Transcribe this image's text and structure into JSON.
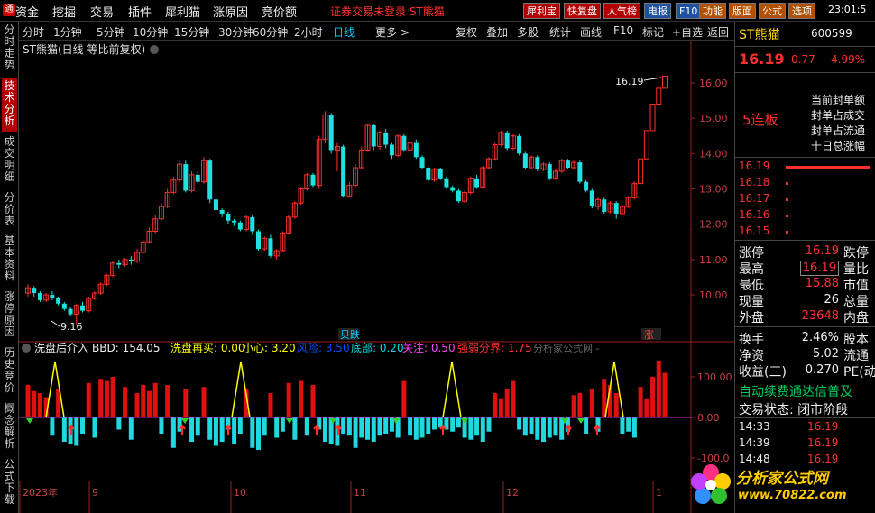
{
  "menubar": {
    "items": [
      "资金",
      "挖掘",
      "交易",
      "插件",
      "犀利猫",
      "涨原因",
      "竞价额"
    ],
    "login_status": "证券交易未登录  ST熊猫",
    "buttons": [
      "犀利宝",
      "快复盘",
      "人气榜",
      "电报",
      "F10",
      "功能",
      "版面",
      "公式",
      "选项"
    ],
    "clock": "23:01:5"
  },
  "left_tabs": [
    "分时走势",
    "技术分析",
    "成交明细",
    "分价表",
    "基本资料",
    "涨停原因",
    "历史竞价",
    "概念解析",
    "公式下载"
  ],
  "left_tabs_active": "技术分析",
  "periods": [
    "分时",
    "1分钟",
    "5分钟",
    "10分钟",
    "15分钟",
    "30分钟",
    "60分钟",
    "2小时",
    "日线",
    "更多 >"
  ],
  "period_selected": "日线",
  "tools": [
    "复权",
    "叠加",
    "多股",
    "统计",
    "画线",
    "F10",
    "标记",
    "+自选",
    "返回"
  ],
  "chart": {
    "title": "ST熊猫(日线 等比前复权)",
    "high_label": "16.19",
    "low_label": "9.16",
    "event_label_1": "贝跌",
    "event_label_2": "涨",
    "price_axis": [
      "16.00",
      "15.00",
      "14.00",
      "13.00",
      "12.00",
      "11.00",
      "10.00"
    ],
    "indicator_axis": [
      "100.00",
      "0.00",
      "-100.0"
    ],
    "x_labels": [
      "2023年",
      "9",
      "10",
      "11",
      "12",
      "1"
    ]
  },
  "indicator": {
    "name": "洗盘后介入",
    "bbd": "BBD: 154.05",
    "xipan": "洗盘再买: 0.00",
    "xiaoxin": "小心: 3.20",
    "fengxian": "风险: 3.50",
    "dibu": "底部: 0.20",
    "guanzhu": "关注: 0.50",
    "qiangruo": "强弱分界: 1.75",
    "source": "分析家公式网 -"
  },
  "chart_data": {
    "type": "candlestick",
    "candles": [
      [
        10.05,
        10.2,
        10.3,
        9.95
      ],
      [
        10.2,
        10.05,
        10.25,
        9.95
      ],
      [
        10.05,
        9.85,
        10.1,
        9.8
      ],
      [
        9.85,
        10.0,
        10.05,
        9.8
      ],
      [
        10.0,
        9.9,
        10.1,
        9.85
      ],
      [
        9.9,
        9.75,
        9.95,
        9.7
      ],
      [
        9.75,
        9.6,
        9.8,
        9.55
      ],
      [
        9.6,
        9.45,
        9.65,
        9.4
      ],
      [
        9.45,
        9.7,
        9.75,
        9.16
      ],
      [
        9.7,
        9.55,
        9.8,
        9.5
      ],
      [
        9.55,
        9.9,
        9.95,
        9.5
      ],
      [
        9.9,
        10.05,
        10.1,
        9.85
      ],
      [
        10.05,
        10.3,
        10.35,
        10.0
      ],
      [
        10.3,
        10.55,
        10.6,
        10.25
      ],
      [
        10.55,
        10.9,
        10.95,
        10.5
      ],
      [
        10.9,
        10.85,
        11.0,
        10.75
      ],
      [
        10.85,
        11.0,
        11.05,
        10.8
      ],
      [
        11.0,
        10.95,
        11.1,
        10.85
      ],
      [
        10.95,
        11.2,
        11.3,
        10.9
      ],
      [
        11.2,
        11.5,
        11.55,
        11.15
      ],
      [
        11.5,
        11.8,
        11.9,
        11.45
      ],
      [
        11.8,
        12.15,
        12.25,
        11.75
      ],
      [
        12.15,
        12.5,
        12.6,
        12.1
      ],
      [
        12.5,
        12.9,
        13.0,
        12.45
      ],
      [
        12.9,
        13.25,
        13.35,
        12.85
      ],
      [
        13.25,
        13.7,
        13.8,
        13.2
      ],
      [
        13.7,
        12.95,
        13.8,
        12.9
      ],
      [
        12.95,
        13.4,
        13.5,
        12.9
      ],
      [
        13.4,
        13.2,
        13.5,
        13.15
      ],
      [
        13.2,
        13.8,
        13.9,
        13.15
      ],
      [
        13.8,
        12.7,
        13.85,
        12.6
      ],
      [
        12.7,
        12.4,
        12.75,
        12.3
      ],
      [
        12.4,
        12.3,
        12.45,
        12.2
      ],
      [
        12.3,
        12.1,
        12.35,
        12.0
      ],
      [
        12.1,
        12.05,
        12.15,
        11.95
      ],
      [
        12.05,
        11.85,
        12.1,
        11.8
      ],
      [
        11.85,
        12.2,
        12.25,
        11.8
      ],
      [
        12.2,
        11.8,
        12.25,
        11.7
      ],
      [
        11.8,
        11.3,
        11.85,
        11.25
      ],
      [
        11.3,
        11.6,
        11.65,
        11.25
      ],
      [
        11.6,
        11.1,
        11.7,
        11.05
      ],
      [
        11.1,
        11.25,
        11.3,
        11.0
      ],
      [
        11.25,
        11.75,
        11.8,
        11.2
      ],
      [
        11.75,
        12.2,
        12.25,
        11.7
      ],
      [
        12.2,
        12.6,
        12.65,
        12.15
      ],
      [
        12.6,
        13.0,
        13.05,
        12.55
      ],
      [
        13.0,
        13.4,
        13.45,
        12.95
      ],
      [
        13.4,
        13.1,
        13.45,
        13.05
      ],
      [
        13.1,
        14.4,
        14.5,
        13.0
      ],
      [
        14.4,
        15.1,
        15.2,
        14.3
      ],
      [
        15.1,
        14.1,
        15.15,
        14.0
      ],
      [
        14.1,
        14.2,
        14.3,
        13.5
      ],
      [
        14.2,
        12.8,
        14.25,
        12.75
      ],
      [
        12.8,
        13.1,
        13.2,
        12.75
      ],
      [
        13.1,
        13.6,
        13.7,
        13.05
      ],
      [
        13.6,
        14.1,
        14.2,
        13.55
      ],
      [
        14.1,
        14.8,
        14.85,
        14.05
      ],
      [
        14.8,
        14.2,
        14.85,
        14.1
      ],
      [
        14.2,
        14.6,
        14.65,
        14.1
      ],
      [
        14.6,
        14.25,
        14.7,
        14.15
      ],
      [
        14.25,
        13.95,
        14.3,
        13.85
      ],
      [
        13.95,
        14.5,
        14.55,
        13.9
      ],
      [
        14.5,
        14.1,
        14.55,
        14.05
      ],
      [
        14.1,
        14.3,
        14.35,
        14.05
      ],
      [
        14.3,
        13.9,
        14.4,
        13.85
      ],
      [
        13.9,
        13.6,
        13.95,
        13.55
      ],
      [
        13.6,
        13.25,
        13.65,
        13.2
      ],
      [
        13.25,
        13.55,
        13.6,
        13.2
      ],
      [
        13.55,
        13.3,
        13.6,
        13.25
      ],
      [
        13.3,
        13.05,
        13.35,
        13.0
      ],
      [
        13.05,
        12.95,
        13.1,
        12.9
      ],
      [
        12.95,
        12.65,
        13.0,
        12.6
      ],
      [
        12.65,
        12.9,
        12.95,
        12.6
      ],
      [
        12.9,
        13.3,
        13.35,
        12.85
      ],
      [
        13.3,
        13.05,
        13.4,
        13.0
      ],
      [
        13.05,
        13.6,
        13.65,
        13.0
      ],
      [
        13.6,
        13.85,
        13.9,
        13.55
      ],
      [
        13.85,
        14.25,
        14.3,
        13.8
      ],
      [
        14.25,
        14.6,
        14.65,
        14.2
      ],
      [
        14.6,
        14.15,
        14.65,
        14.1
      ],
      [
        14.15,
        14.5,
        14.55,
        14.1
      ],
      [
        14.5,
        14.0,
        14.55,
        13.95
      ],
      [
        14.0,
        13.6,
        14.05,
        13.55
      ],
      [
        13.6,
        13.9,
        13.95,
        13.55
      ],
      [
        13.9,
        13.55,
        13.95,
        13.5
      ],
      [
        13.55,
        13.7,
        13.75,
        13.5
      ],
      [
        13.7,
        13.3,
        13.75,
        13.25
      ],
      [
        13.3,
        13.5,
        13.55,
        13.25
      ],
      [
        13.5,
        13.8,
        13.85,
        13.45
      ],
      [
        13.8,
        13.6,
        13.85,
        13.55
      ],
      [
        13.6,
        13.75,
        13.8,
        13.55
      ],
      [
        13.75,
        13.2,
        13.8,
        13.15
      ],
      [
        13.2,
        12.95,
        13.25,
        12.9
      ],
      [
        12.95,
        12.5,
        13.0,
        12.45
      ],
      [
        12.5,
        12.7,
        12.75,
        12.4
      ],
      [
        12.7,
        12.35,
        12.75,
        12.3
      ],
      [
        12.35,
        12.6,
        12.65,
        12.3
      ],
      [
        12.6,
        12.3,
        12.65,
        12.15
      ],
      [
        12.3,
        12.5,
        12.55,
        12.25
      ],
      [
        12.5,
        12.75,
        12.8,
        12.45
      ],
      [
        12.75,
        13.15,
        13.2,
        12.7
      ],
      [
        13.15,
        13.85,
        13.85,
        13.85
      ],
      [
        13.85,
        14.65,
        14.65,
        14.65
      ],
      [
        14.65,
        15.4,
        15.4,
        15.4
      ],
      [
        15.4,
        15.85,
        15.85,
        15.85
      ],
      [
        15.85,
        16.19,
        16.19,
        16.19
      ]
    ],
    "osc_values": [
      80,
      65,
      60,
      50,
      -45,
      70,
      -60,
      -65,
      -70,
      -40,
      85,
      -50,
      95,
      90,
      100,
      -30,
      75,
      -55,
      60,
      80,
      65,
      85,
      -40,
      80,
      -75,
      -35,
      70,
      -60,
      -45,
      75,
      -55,
      -70,
      -60,
      -30,
      -65,
      -40,
      70,
      -75,
      -80,
      -45,
      60,
      -50,
      -35,
      85,
      -55,
      90,
      -45,
      80,
      -30,
      -60,
      -65,
      -70,
      -40,
      -45,
      -75,
      -50,
      -55,
      -60,
      -45,
      -40,
      -35,
      -50,
      90,
      -45,
      -55,
      -50,
      -40,
      -30,
      -25,
      -30,
      -35,
      -25,
      -50,
      -55,
      -45,
      -60,
      -35,
      60,
      45,
      70,
      90,
      -30,
      -45,
      -40,
      -55,
      -60,
      -50,
      -45,
      -55,
      -35,
      55,
      60,
      -40,
      70,
      -35,
      95,
      80,
      60,
      -40,
      -35,
      -50,
      75,
      45,
      100,
      140,
      110
    ]
  }
}
